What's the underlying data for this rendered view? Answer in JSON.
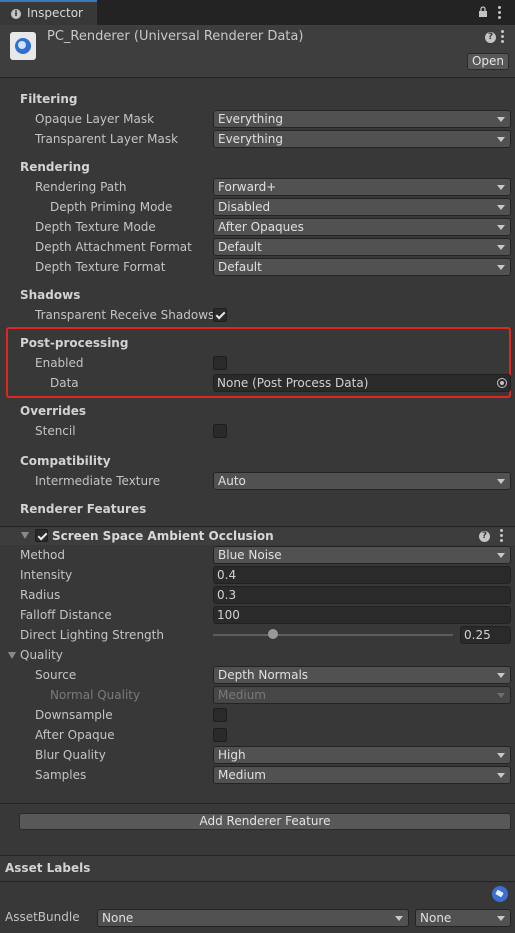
{
  "tab": {
    "title": "Inspector"
  },
  "asset": {
    "title": "PC_Renderer (Universal Renderer Data)",
    "open_label": "Open"
  },
  "filtering": {
    "header": "Filtering",
    "opaque_label": "Opaque Layer Mask",
    "opaque_value": "Everything",
    "transparent_label": "Transparent Layer Mask",
    "transparent_value": "Everything"
  },
  "rendering": {
    "header": "Rendering",
    "path_label": "Rendering Path",
    "path_value": "Forward+",
    "priming_label": "Depth Priming Mode",
    "priming_value": "Disabled",
    "texmode_label": "Depth Texture Mode",
    "texmode_value": "After Opaques",
    "attach_label": "Depth Attachment Format",
    "attach_value": "Default",
    "texformat_label": "Depth Texture Format",
    "texformat_value": "Default"
  },
  "shadows": {
    "header": "Shadows",
    "transparent_label": "Transparent Receive Shadows",
    "transparent_checked": true
  },
  "postprocessing": {
    "header": "Post-processing",
    "enabled_label": "Enabled",
    "enabled_checked": false,
    "data_label": "Data",
    "data_value": "None (Post Process Data)",
    "highlight_color": "#e0261f"
  },
  "overrides": {
    "header": "Overrides",
    "stencil_label": "Stencil",
    "stencil_checked": false
  },
  "compatibility": {
    "header": "Compatibility",
    "intermediate_label": "Intermediate Texture",
    "intermediate_value": "Auto"
  },
  "renderer_features": {
    "header": "Renderer Features",
    "ssao": {
      "title": "Screen Space Ambient Occlusion",
      "enabled": true,
      "method_label": "Method",
      "method_value": "Blue Noise",
      "intensity_label": "Intensity",
      "intensity_value": "0.4",
      "radius_label": "Radius",
      "radius_value": "0.3",
      "falloff_label": "Falloff Distance",
      "falloff_value": "100",
      "direct_label": "Direct Lighting Strength",
      "direct_value": "0.25",
      "direct_fraction": 0.25,
      "quality_header": "Quality",
      "source_label": "Source",
      "source_value": "Depth Normals",
      "normal_label": "Normal Quality",
      "normal_value": "Medium",
      "downsample_label": "Downsample",
      "downsample_checked": false,
      "after_opaque_label": "After Opaque",
      "after_opaque_checked": false,
      "blur_label": "Blur Quality",
      "blur_value": "High",
      "samples_label": "Samples",
      "samples_value": "Medium"
    },
    "add_button": "Add Renderer Feature"
  },
  "asset_labels": {
    "header": "Asset Labels",
    "bundle_label": "AssetBundle",
    "bundle_value": "None",
    "variant_value": "None",
    "tag_color": "#3b6fd1"
  },
  "icons": [
    "info-icon",
    "lock-icon",
    "kebab-menu-icon",
    "asset-file-icon",
    "help-icon",
    "object-picker-icon",
    "foldout-arrow-icon",
    "tag-icon"
  ]
}
